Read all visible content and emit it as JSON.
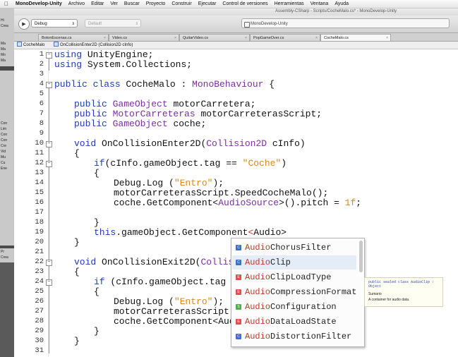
{
  "menubar": {
    "apple": "",
    "items": [
      "MonoDevelop-Unity",
      "Archivo",
      "Editar",
      "Ver",
      "Buscar",
      "Proyecto",
      "Construir",
      "Ejecutar",
      "Control de versiones",
      "Herramientas",
      "Ventana",
      "Ayuda"
    ]
  },
  "window": {
    "title": "Assembly-CSharp - Scripts/CocheMalo.cs* - MonoDevelop-Unity"
  },
  "toolbar": {
    "run_icon": "play-icon",
    "config_value": "Debug",
    "target_value": "Default",
    "status_text": "MonoDevelop-Unity"
  },
  "left_panel": {
    "rows_top": [
      "Hi",
      "Crea",
      "Ma",
      "Ma",
      "Mo",
      "Ma"
    ],
    "rows_mid": [
      "Con",
      "Lim",
      "Con",
      "Con",
      "Cre",
      "Vid",
      "Mu",
      "Cu",
      "Ene"
    ],
    "rows_bottom": [
      "Pr",
      "Crea"
    ]
  },
  "tabs": [
    "BotonEscenas.cs",
    "Video.cs",
    "QuitarVideo.cs",
    "PopGameOver.cs",
    "CocheMalo.cs"
  ],
  "pathbar": {
    "file": "CocheMalo",
    "member": "OnCollisionEnter2D (Collision2D cInfo)"
  },
  "editor": {
    "line_numbers": [
      "1",
      "2",
      "3",
      "4",
      "5",
      "6",
      "7",
      "8",
      "9",
      "10",
      "11",
      "12",
      "13",
      "14",
      "15",
      "16",
      "17",
      "18",
      "19",
      "20",
      "21",
      "22",
      "23",
      "24",
      "25",
      "26",
      "27",
      "28",
      "29",
      "30",
      "31"
    ],
    "lines": {
      "l1_kw": "using",
      "l1_rest": " UnityEngine;",
      "l2_kw": "using",
      "l2_rest": " System.Collections;",
      "l4_kw": "public class",
      "l4_name": " CocheMalo : ",
      "l4_base": "MonoBehaviour",
      "l4_brace": " {",
      "l6_kw": "public",
      "l6_ty": " GameObject",
      "l6_rest": " motorCarretera;",
      "l7_kw": "public",
      "l7_ty": " MotorCarreteras",
      "l7_rest": " motorCarreterasScript;",
      "l8_kw": "public",
      "l8_ty": " GameObject",
      "l8_rest": " coche;",
      "l10_kw": "void",
      "l10_mid": " OnCollisionEnter2D(",
      "l10_ty": "Collision2D",
      "l10_rest": " cInfo)",
      "l11": "{",
      "l12_kw": "if",
      "l12_mid": "(cInfo.gameObject.tag == ",
      "l12_st": "\"Coche\"",
      "l12_end": ")",
      "l13": "{",
      "l14_mid": "Debug.Log (",
      "l14_st": "\"Entro\"",
      "l14_end": ");",
      "l15": "motorCarreterasScript.SpeedCocheMalo();",
      "l16_pre": "coche.GetComponent<",
      "l16_ty": "AudioSource",
      "l16_mid": ">().pitch = ",
      "l16_nu": "1f",
      "l16_end": ";",
      "l18": "}",
      "l19_kw": "this",
      "l19_mid": ".gameObject.GetComponent",
      "l19_lt": "<",
      "l19_end": "Audio>",
      "l20": "}",
      "l22_kw": "void",
      "l22_mid": " OnCollisionExit2D(",
      "l22_ty": "Collision",
      "l23": "{",
      "l24_kw": "if",
      "l24_mid": " (cInfo.gameObject.tag ==",
      "l25": "{",
      "l26_mid": "Debug.Log (",
      "l26_st": "\"Entro\"",
      "l26_end": ");",
      "l27": "motorCarreterasScript.Sp",
      "l28": "coche.GetComponent<Audio",
      "l29": "}",
      "l30": "}"
    }
  },
  "completion": {
    "items": [
      {
        "prefix": "Audio",
        "rest": "ChorusFilter",
        "icon": "class-icon",
        "color": "#3f6fc6"
      },
      {
        "prefix": "Audio",
        "rest": "Clip",
        "icon": "class-icon",
        "color": "#3f6fc6"
      },
      {
        "prefix": "Audio",
        "rest": "ClipLoadType",
        "icon": "enum-icon",
        "color": "#d9534f"
      },
      {
        "prefix": "Audio",
        "rest": "CompressionFormat",
        "icon": "enum-icon",
        "color": "#d9534f"
      },
      {
        "prefix": "Audio",
        "rest": "Configuration",
        "icon": "struct-icon",
        "color": "#4caf50"
      },
      {
        "prefix": "Audio",
        "rest": "DataLoadState",
        "icon": "enum-icon",
        "color": "#d9534f"
      },
      {
        "prefix": "Audio",
        "rest": "DistortionFilter",
        "icon": "class-icon",
        "color": "#3f6fc6"
      }
    ],
    "selected_index": 1
  },
  "tooltip": {
    "signature": "public sealed class AudioClip : Object",
    "heading": "Sumario",
    "description": "A container for audio data."
  }
}
